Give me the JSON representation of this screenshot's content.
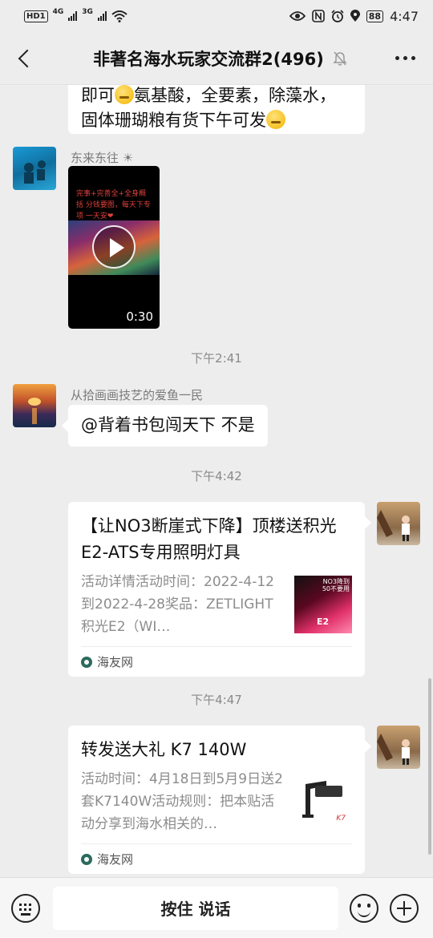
{
  "status_bar": {
    "hd_label": "HD",
    "hd_sub": "1",
    "net_1": "4G",
    "net_2": "3G",
    "battery": "88",
    "time": "4:47"
  },
  "header": {
    "title": "非著名海水玩家交流群2(496)"
  },
  "messages": {
    "msg1": {
      "line1_prefix": "即可",
      "line1_mid": "氨基酸，全要素，除藻水，",
      "line2": "固体珊瑚粮有货下午可发"
    },
    "msg2": {
      "sender": "东来东往 ☀",
      "video_overlay": "完事+完善全+全身概括 分钱要图，每天下专项 一天安❤",
      "duration": "0:30"
    },
    "time1": "下午2:41",
    "msg3": {
      "sender": "从拾画画技艺的爱鱼一民",
      "text": "@背着书包闯天下  不是"
    },
    "time2": "下午4:42",
    "card1": {
      "title": "【让NO3断崖式下降】顶楼送积光E2-ATS专用照明灯具",
      "desc": "活动详情活动时间：2022-4-12到2022-4-28奖品：ZETLIGHT积光E2（WI…",
      "thumb_label": "NO3降到 50不要用",
      "thumb_model": "E2",
      "source": "海友网"
    },
    "time3": "下午4:47",
    "card2": {
      "title": "转发送大礼 K7 140W",
      "desc": "活动时间：4月18日到5月9日送2套K7140W活动规则：把本贴活动分享到海水相关的…",
      "thumb_label": "K7",
      "source": "海友网"
    }
  },
  "bottom_bar": {
    "hold_to_talk": "按住 说话"
  },
  "colors": {
    "background": "#ededed",
    "bubble": "#ffffff",
    "card_desc": "#8c8c8c"
  }
}
